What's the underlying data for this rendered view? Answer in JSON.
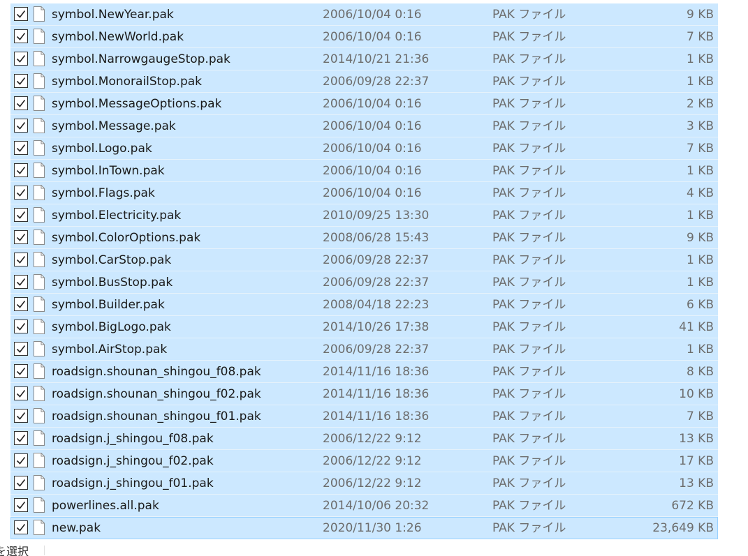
{
  "file_type_label": "PAK ファイル",
  "files": [
    {
      "name": "symbol.NewYear.pak",
      "date": "2006/10/04 0:16",
      "size": "9 KB"
    },
    {
      "name": "symbol.NewWorld.pak",
      "date": "2006/10/04 0:16",
      "size": "7 KB"
    },
    {
      "name": "symbol.NarrowgaugeStop.pak",
      "date": "2014/10/21 21:36",
      "size": "1 KB"
    },
    {
      "name": "symbol.MonorailStop.pak",
      "date": "2006/09/28 22:37",
      "size": "1 KB"
    },
    {
      "name": "symbol.MessageOptions.pak",
      "date": "2006/10/04 0:16",
      "size": "2 KB"
    },
    {
      "name": "symbol.Message.pak",
      "date": "2006/10/04 0:16",
      "size": "3 KB"
    },
    {
      "name": "symbol.Logo.pak",
      "date": "2006/10/04 0:16",
      "size": "7 KB"
    },
    {
      "name": "symbol.InTown.pak",
      "date": "2006/10/04 0:16",
      "size": "1 KB"
    },
    {
      "name": "symbol.Flags.pak",
      "date": "2006/10/04 0:16",
      "size": "4 KB"
    },
    {
      "name": "symbol.Electricity.pak",
      "date": "2010/09/25 13:30",
      "size": "1 KB"
    },
    {
      "name": "symbol.ColorOptions.pak",
      "date": "2008/06/28 15:43",
      "size": "9 KB"
    },
    {
      "name": "symbol.CarStop.pak",
      "date": "2006/09/28 22:37",
      "size": "1 KB"
    },
    {
      "name": "symbol.BusStop.pak",
      "date": "2006/09/28 22:37",
      "size": "1 KB"
    },
    {
      "name": "symbol.Builder.pak",
      "date": "2008/04/18 22:23",
      "size": "6 KB"
    },
    {
      "name": "symbol.BigLogo.pak",
      "date": "2014/10/26 17:38",
      "size": "41 KB"
    },
    {
      "name": "symbol.AirStop.pak",
      "date": "2006/09/28 22:37",
      "size": "1 KB"
    },
    {
      "name": "roadsign.shounan_shingou_f08.pak",
      "date": "2014/11/16 18:36",
      "size": "8 KB"
    },
    {
      "name": "roadsign.shounan_shingou_f02.pak",
      "date": "2014/11/16 18:36",
      "size": "10 KB"
    },
    {
      "name": "roadsign.shounan_shingou_f01.pak",
      "date": "2014/11/16 18:36",
      "size": "7 KB"
    },
    {
      "name": "roadsign.j_shingou_f08.pak",
      "date": "2006/12/22 9:12",
      "size": "13 KB"
    },
    {
      "name": "roadsign.j_shingou_f02.pak",
      "date": "2006/12/22 9:12",
      "size": "17 KB"
    },
    {
      "name": "roadsign.j_shingou_f01.pak",
      "date": "2006/12/22 9:12",
      "size": "13 KB"
    },
    {
      "name": "powerlines.all.pak",
      "date": "2014/10/06 20:32",
      "size": "672 KB"
    },
    {
      "name": "new.pak",
      "date": "2020/11/30 1:26",
      "size": "23,649 KB",
      "focused": true
    }
  ],
  "status_bar": {
    "selection_text": "を選択"
  },
  "colors": {
    "selection_bg": "#cce8ff",
    "focus_border": "#99d1ff"
  },
  "icons": {
    "checkbox": "checkbox-checked-icon",
    "file": "file-icon"
  }
}
